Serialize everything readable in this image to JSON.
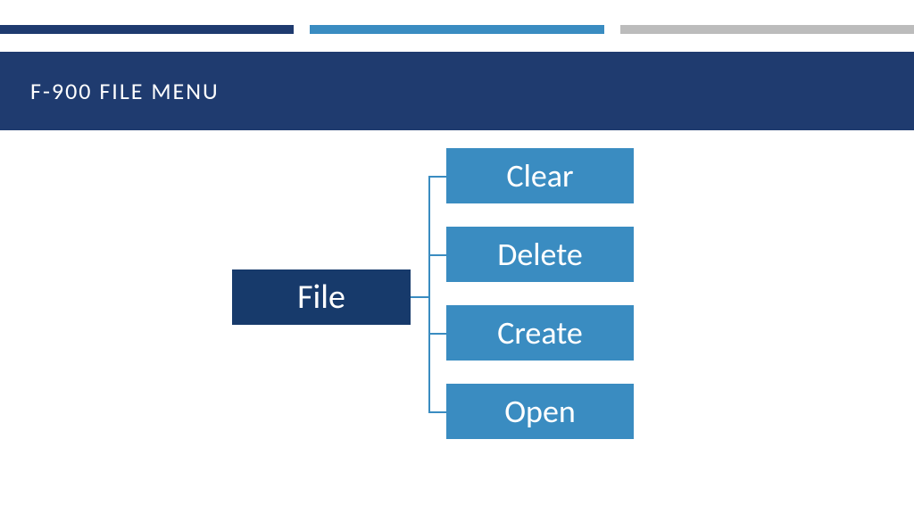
{
  "colors": {
    "dark": "#1f3b6f",
    "mid": "#3a8cc1",
    "grey": "#bcbcbc",
    "parent": "#173a6b"
  },
  "title": "F-900 FILE MENU",
  "menu": {
    "parent": "File",
    "children": [
      "Clear",
      "Delete",
      "Create",
      "Open"
    ]
  }
}
